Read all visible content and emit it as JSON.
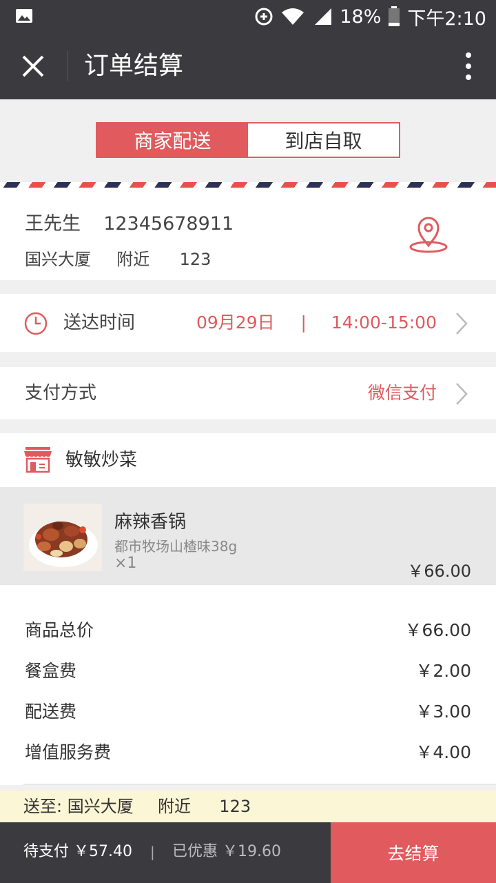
{
  "status_bar": {
    "battery": "18%",
    "time": "下午2:10"
  },
  "title_bar": {
    "title": "订单结算"
  },
  "tabs": [
    {
      "label": "商家配送",
      "active": true
    },
    {
      "label": "到店自取",
      "active": false
    }
  ],
  "address": {
    "name": "王先生",
    "phone": "12345678911",
    "building": "国兴大厦",
    "area": "附近",
    "detail": "123"
  },
  "delivery_time": {
    "label": "送达时间",
    "date": "09月29日",
    "separator": "|",
    "time": "14:00-15:00"
  },
  "payment": {
    "label": "支付方式",
    "value": "微信支付"
  },
  "shop": {
    "name": "敏敏炒菜"
  },
  "items": [
    {
      "name": "麻辣香锅",
      "desc": "都市牧场山楂味38g",
      "qty": "×1",
      "price": "￥66.00"
    }
  ],
  "summary": [
    {
      "label": "商品总价",
      "value": "￥66.00"
    },
    {
      "label": "餐盒费",
      "value": "￥2.00"
    },
    {
      "label": "配送费",
      "value": "￥3.00"
    },
    {
      "label": "增值服务费",
      "value": "￥4.00"
    }
  ],
  "deliver_to": {
    "prefix": "送至:",
    "building": "国兴大厦",
    "area": "附近",
    "detail": "123"
  },
  "bottom_bar": {
    "pending": "待支付 ￥57.40",
    "separator": "|",
    "saved": "已优惠 ￥19.60",
    "checkout": "去结算"
  },
  "colors": {
    "accent": "#e05a5e",
    "dark": "#3b3b3f",
    "notice_bg": "#fbf6d6"
  }
}
